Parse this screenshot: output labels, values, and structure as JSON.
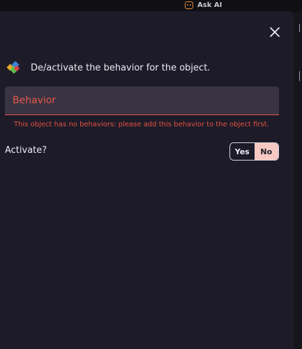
{
  "topbar": {
    "ask_ai_label": "Ask AI"
  },
  "dialog": {
    "description": "De/activate the behavior for the object.",
    "behavior_field": {
      "label": "Behavior",
      "error": "This object has no behaviors: please add this behavior to the object first."
    },
    "activate": {
      "label": "Activate?",
      "yes_label": "Yes",
      "no_label": "No",
      "selected": "No"
    }
  },
  "colors": {
    "dialog_background": "#1e1b29",
    "error": "#e5523f",
    "selected_option": "#f7c9c2"
  }
}
